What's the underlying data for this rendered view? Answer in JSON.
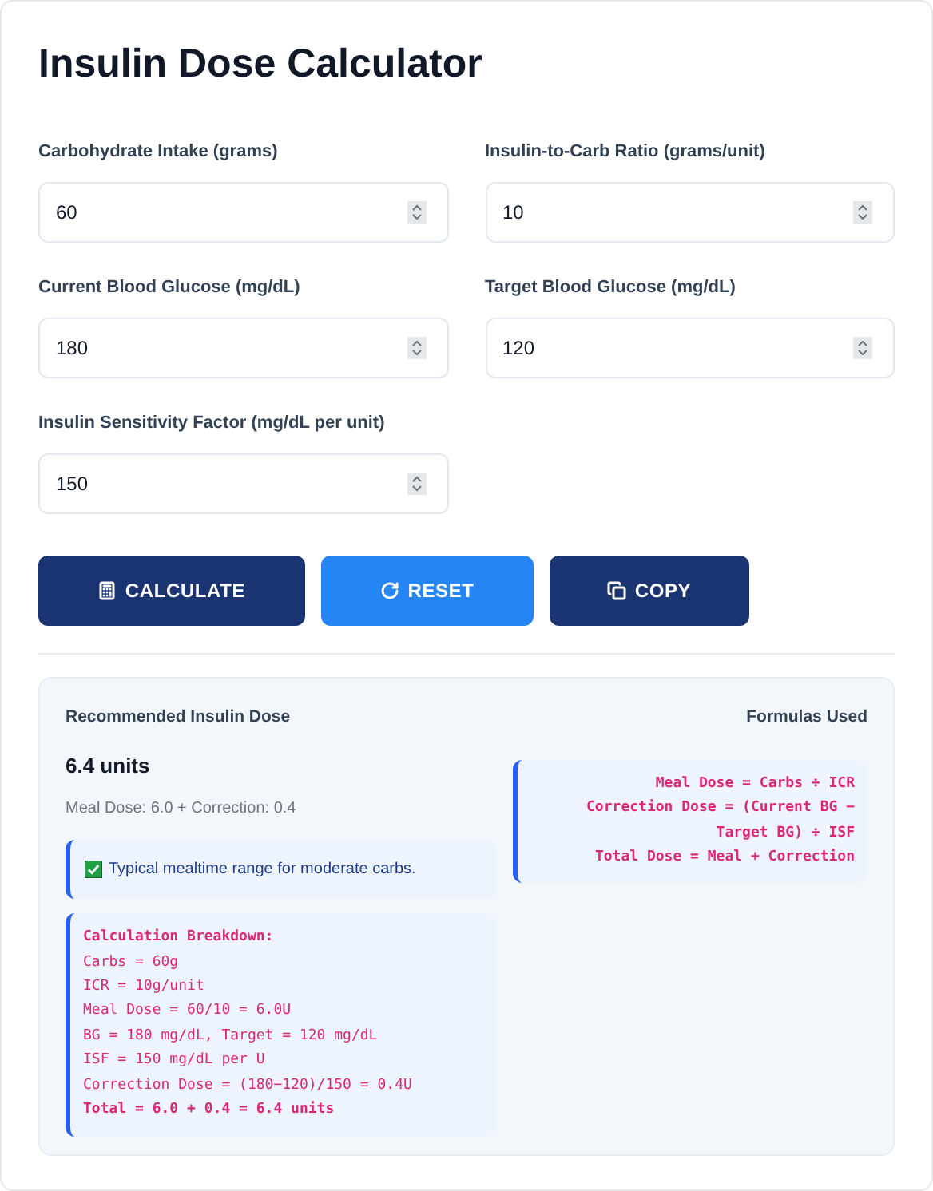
{
  "title": "Insulin Dose Calculator",
  "fields": [
    {
      "label": "Carbohydrate Intake (grams)",
      "value": "60"
    },
    {
      "label": "Insulin-to-Carb Ratio (grams/unit)",
      "value": "10"
    },
    {
      "label": "Current Blood Glucose (mg/dL)",
      "value": "180"
    },
    {
      "label": "Target Blood Glucose (mg/dL)",
      "value": "120"
    },
    {
      "label": "Insulin Sensitivity Factor (mg/dL per unit)",
      "value": "150"
    }
  ],
  "buttons": [
    {
      "kind": "calculate",
      "label": "CALCULATE"
    },
    {
      "kind": "reset",
      "label": "RESET"
    },
    {
      "kind": "copy",
      "label": "COPY"
    }
  ],
  "result": {
    "heading": "Recommended Insulin Dose",
    "dose": "6.4 units",
    "detail": "Meal Dose: 6.0 + Correction: 0.4",
    "note": "Typical mealtime range for moderate carbs.",
    "breakdown": {
      "title": "Calculation Breakdown:",
      "lines": [
        "Carbs = 60g",
        "ICR = 10g/unit",
        "Meal Dose = 60/10 = 6.0U",
        "BG = 180 mg/dL, Target = 120 mg/dL",
        "ISF = 150 mg/dL per U",
        "Correction Dose = (180−120)/150 = 0.4U"
      ],
      "total": "Total = 6.0 + 0.4 = 6.4 units"
    }
  },
  "formulas": {
    "heading": "Formulas Used",
    "lines": [
      "Meal Dose = Carbs ÷ ICR",
      "Correction Dose = (Current BG − Target BG) ÷ ISF",
      "Total Dose = Meal + Correction"
    ]
  }
}
